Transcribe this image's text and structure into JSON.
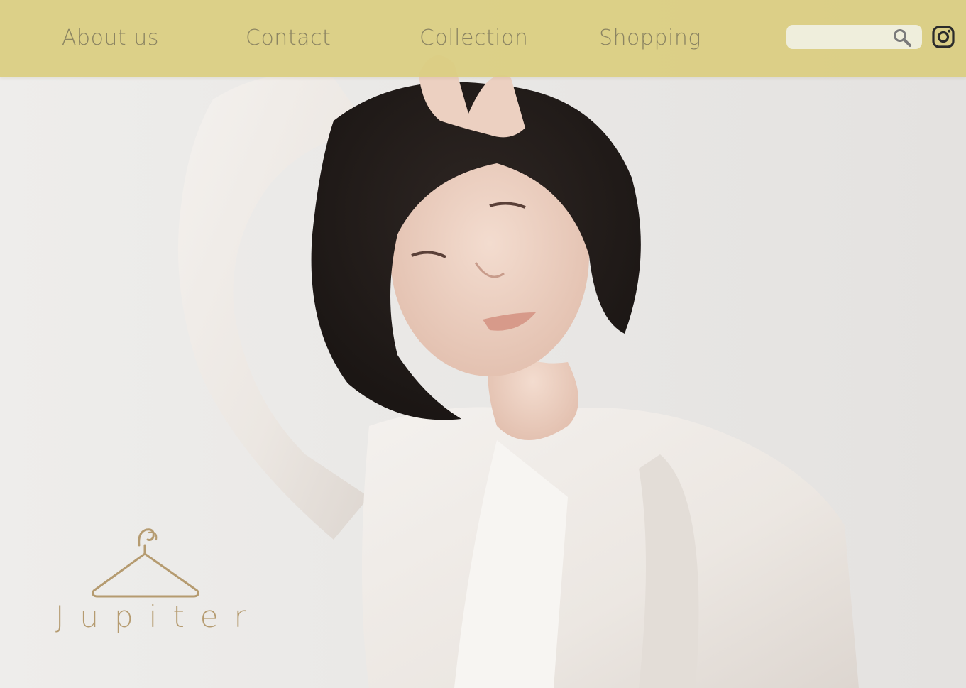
{
  "nav": {
    "items": [
      {
        "label": "About us"
      },
      {
        "label": "Contact"
      },
      {
        "label": "Collection"
      },
      {
        "label": "Shopping"
      }
    ]
  },
  "search": {
    "value": "",
    "placeholder": "",
    "icon": "search-icon"
  },
  "social": {
    "icon": "instagram-icon"
  },
  "logo": {
    "icon": "clothes-hanger-icon",
    "brand": "Jupiter"
  },
  "colors": {
    "nav_bar": "#dacf80",
    "nav_text": "#8b8462",
    "brand": "#b59b70",
    "search_field": "#efeedc",
    "background": "#eae8e6"
  }
}
